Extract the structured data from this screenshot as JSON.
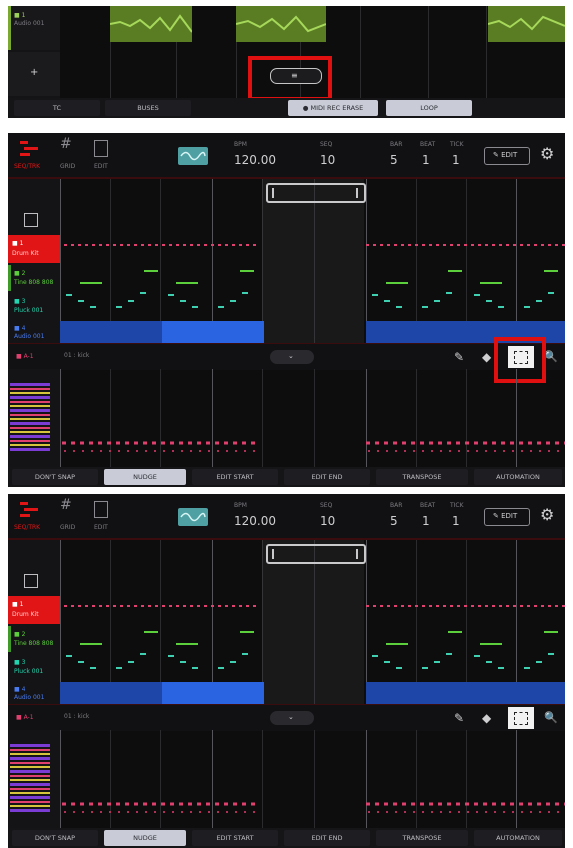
{
  "screen1": {
    "tracks": [
      {
        "label": "■ 1",
        "sub": "Audio 001"
      }
    ],
    "add_track": "+",
    "pill": "≡",
    "buttons": [
      "TC",
      "BUSES",
      "● MIDI REC ERASE",
      "LOOP"
    ]
  },
  "screen2": {
    "header": {
      "nav": [
        "SEQ/TRK",
        "GRID",
        "EDIT"
      ],
      "bpm_label": "BPM",
      "bpm": "120.00",
      "seq_label": "SEQ",
      "seq": "10",
      "bar_label": "BAR",
      "bar": "5",
      "beat_label": "BEAT",
      "beat": "1",
      "tick_label": "TICK",
      "tick": "1",
      "edit_button": "✎ EDIT",
      "settings_icon": "⚙"
    },
    "tracks": [
      {
        "label": "■ 1",
        "sub": "Drum Kit",
        "color": "#e11515"
      },
      {
        "label": "■ 2",
        "sub": "Tine 808 808",
        "color": "#3f9a2a"
      },
      {
        "label": "■ 3",
        "sub": "Pluck 001",
        "color": "#22a68c"
      },
      {
        "label": "■ 4",
        "sub": "Audio 001",
        "color": "#2a5bd6"
      }
    ],
    "lane_header": {
      "pad": "■ A-1",
      "note": "01 : kick"
    },
    "tools": [
      "✎",
      "◆",
      "⬚",
      "🔍"
    ],
    "buttons": [
      "DON'T SNAP",
      "NUDGE",
      "EDIT START",
      "EDIT END",
      "TRANSPOSE",
      "AUTOMATION"
    ]
  },
  "screen3": {
    "header": {
      "nav": [
        "SEQ/TRK",
        "GRID",
        "EDIT"
      ],
      "bpm_label": "BPM",
      "bpm": "120.00",
      "seq_label": "SEQ",
      "seq": "10",
      "bar_label": "BAR",
      "bar": "5",
      "beat_label": "BEAT",
      "beat": "1",
      "tick_label": "TICK",
      "tick": "1",
      "edit_button": "✎ EDIT",
      "settings_icon": "⚙"
    },
    "tracks": [
      {
        "label": "■ 1",
        "sub": "Drum Kit",
        "color": "#e11515"
      },
      {
        "label": "■ 2",
        "sub": "Tine 808 808",
        "color": "#3f9a2a"
      },
      {
        "label": "■ 3",
        "sub": "Pluck 001",
        "color": "#22a68c"
      },
      {
        "label": "■ 4",
        "sub": "Audio 001",
        "color": "#2a5bd6"
      }
    ],
    "lane_header": {
      "pad": "■ A-1",
      "note": "01 : kick"
    },
    "tools": [
      "✎",
      "◆",
      "⬚",
      "🔍"
    ],
    "buttons": [
      "DON'T SNAP",
      "NUDGE",
      "EDIT START",
      "EDIT END",
      "TRANSPOSE",
      "AUTOMATION"
    ]
  },
  "colors": {
    "accent_red": "#e01010",
    "audio_green": "#7aa831",
    "note_green": "#5ccf3c",
    "audio_blue": "#2456c8",
    "drum_pink": "#e0406e"
  }
}
